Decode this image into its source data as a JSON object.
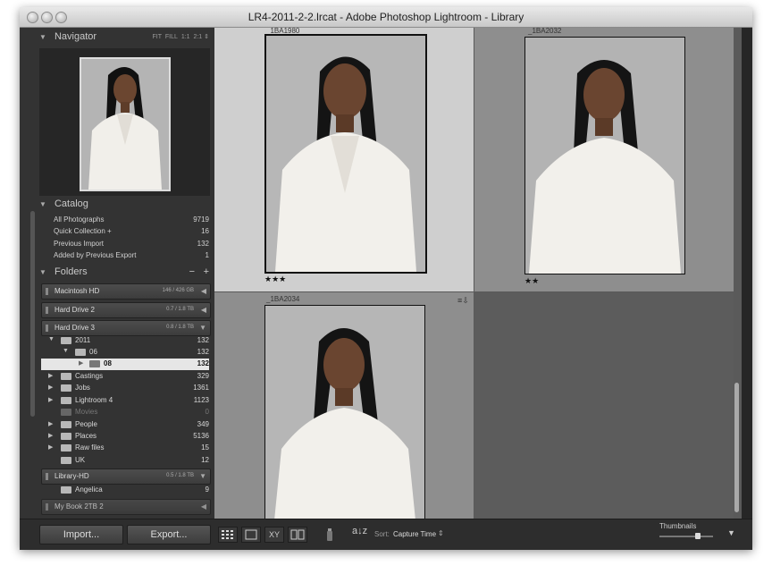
{
  "window": {
    "title": "LR4-2011-2-2.lrcat - Adobe Photoshop Lightroom - Library"
  },
  "navigator": {
    "title": "Navigator",
    "zoom_options": [
      "FIT",
      "FILL",
      "1:1",
      "2:1"
    ]
  },
  "catalog": {
    "title": "Catalog",
    "items": [
      {
        "label": "All Photographs",
        "count": "9719"
      },
      {
        "label": "Quick Collection +",
        "count": "16"
      },
      {
        "label": "Previous Import",
        "count": "132"
      },
      {
        "label": "Added by Previous Export",
        "count": "1"
      }
    ]
  },
  "folders": {
    "title": "Folders",
    "minus": "−",
    "plus": "+",
    "volumes": [
      {
        "name": "Macintosh HD",
        "capacity": "146 / 426 GB"
      },
      {
        "name": "Hard Drive 2",
        "capacity": "0.7 / 1.8 TB"
      },
      {
        "name": "Hard Drive 3",
        "capacity": "0.8 / 1.8 TB"
      }
    ],
    "tree": [
      {
        "name": "2011",
        "count": "132"
      },
      {
        "name": "06",
        "count": "132"
      },
      {
        "name": "08",
        "count": "132"
      },
      {
        "name": "Castings",
        "count": "329"
      },
      {
        "name": "Jobs",
        "count": "1361"
      },
      {
        "name": "Lightroom 4",
        "count": "1123"
      },
      {
        "name": "Movies",
        "count": "0"
      },
      {
        "name": "People",
        "count": "349"
      },
      {
        "name": "Places",
        "count": "5136"
      },
      {
        "name": "Raw files",
        "count": "15"
      },
      {
        "name": "UK",
        "count": "12"
      }
    ],
    "volume_library": {
      "name": "Library-HD",
      "capacity": "0.5 / 1.8 TB"
    },
    "library_tree": [
      {
        "name": "Angelica",
        "count": "9"
      }
    ],
    "volume_mybook": {
      "name": "My Book 2TB 2"
    }
  },
  "buttons": {
    "import": "Import...",
    "export": "Export..."
  },
  "toolbar": {
    "sort_label": "Sort:",
    "sort_value": "Capture Time",
    "thumbnails_label": "Thumbnails",
    "grid_view": "grid-view",
    "thumbnail_size": 0.72
  },
  "grid": {
    "cells": [
      {
        "filename": "_1BA1980",
        "stars": "★★★"
      },
      {
        "filename": "_1BA2032",
        "stars": "★★"
      },
      {
        "filename": "_1BA2034",
        "stars": ""
      }
    ]
  }
}
